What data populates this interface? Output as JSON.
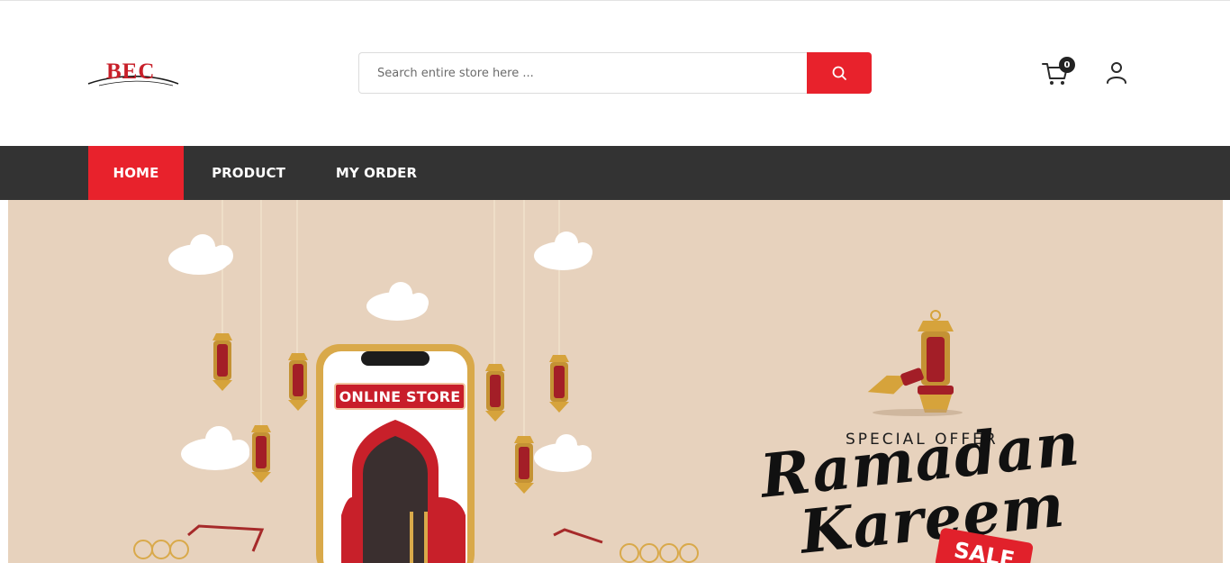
{
  "header": {
    "logo_text": "BEC",
    "search": {
      "placeholder": "Search entire store here ...",
      "value": ""
    },
    "cart_count": "0"
  },
  "nav": {
    "items": [
      {
        "label": "HOME",
        "active": true
      },
      {
        "label": "PRODUCT",
        "active": false
      },
      {
        "label": "MY ORDER",
        "active": false
      }
    ]
  },
  "banner": {
    "phone_label": "ONLINE STORE",
    "offer_label": "SPECIAL OFFER",
    "title_line1": "Ramadan",
    "title_line2": "Kareem",
    "sale_tag": "SALE"
  },
  "colors": {
    "accent": "#e8222c",
    "nav_bg": "#333333",
    "banner_bg": "#e7d2bd"
  },
  "icons": [
    "search-icon",
    "cart-icon",
    "user-icon"
  ]
}
